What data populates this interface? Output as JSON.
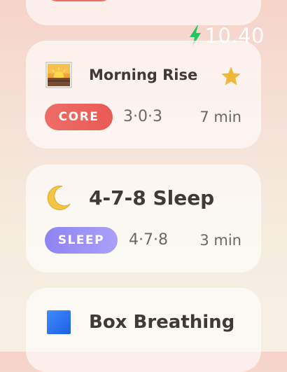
{
  "header": {
    "energy_value": "10.40",
    "energy_icon": "lightning-bolt-icon"
  },
  "exercises": [
    {
      "title": "Morning Rise",
      "icon": "sunrise-icon",
      "favorite": true,
      "category": "CORE",
      "pattern": "3·0·3",
      "duration": "7 min",
      "badge_color": "#ef6a63"
    },
    {
      "title": "4-7-8 Sleep",
      "icon": "crescent-moon-icon",
      "favorite": false,
      "category": "SLEEP",
      "pattern": "4·7·8",
      "duration": "3 min",
      "badge_color": "#9a8ef6"
    },
    {
      "title": "Box Breathing",
      "icon": "blue-square-icon",
      "favorite": false
    }
  ],
  "colors": {
    "accent_star": "#f0b83b",
    "energy_bolt": "#22c55e"
  }
}
